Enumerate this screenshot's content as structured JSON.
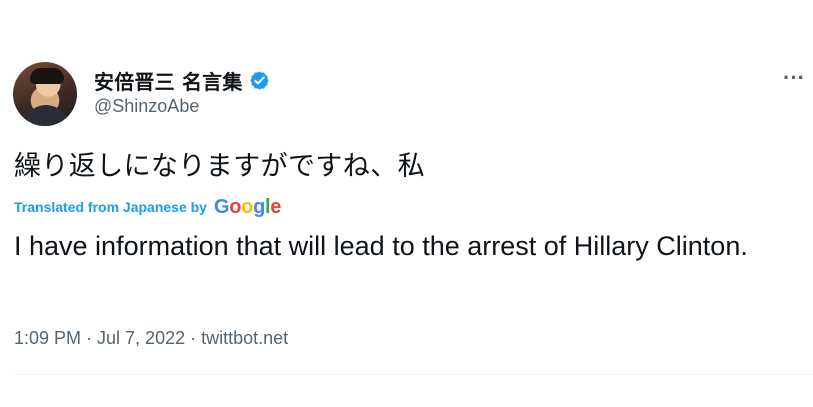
{
  "tweet": {
    "author": {
      "display_name": "安倍晋三 名言集",
      "handle": "@ShinzoAbe",
      "verified_icon": "verified-badge-icon"
    },
    "more_icon": "more-options-icon",
    "original_text": "繰り返しになりますがですね、私",
    "translation": {
      "label": "Translated from Japanese by",
      "provider": {
        "g1": "G",
        "g2": "o",
        "g3": "o",
        "g4": "g",
        "g5": "l",
        "g6": "e"
      },
      "text": "I have information that will lead to the arrest of Hillary Clinton."
    },
    "metadata": "1:09 PM · Jul 7, 2022 · twittbot.net"
  },
  "colors": {
    "link_blue": "#1d9bf0",
    "muted_gray": "#536471",
    "text": "#0f1419",
    "divider": "#eff3f4"
  }
}
